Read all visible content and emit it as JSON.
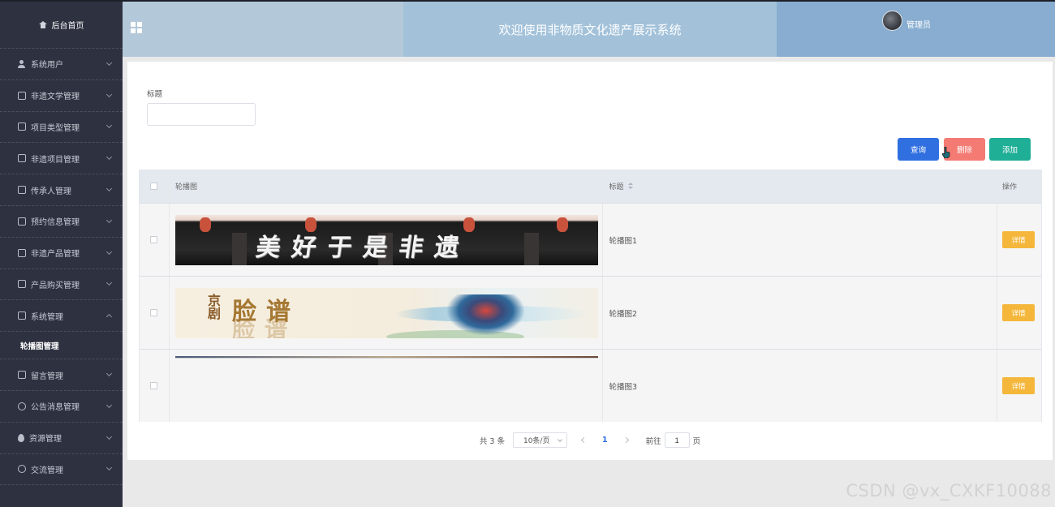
{
  "sidebar": {
    "home": "后台首页",
    "items": [
      {
        "label": "系统用户",
        "icon": "user-icon"
      },
      {
        "label": "非遗文学管理",
        "icon": "document-icon"
      },
      {
        "label": "项目类型管理",
        "icon": "document-icon"
      },
      {
        "label": "非遗项目管理",
        "icon": "document-icon"
      },
      {
        "label": "传承人管理",
        "icon": "document-icon"
      },
      {
        "label": "预约信息管理",
        "icon": "document-icon"
      },
      {
        "label": "非遗产品管理",
        "icon": "document-icon"
      },
      {
        "label": "产品购买管理",
        "icon": "document-icon"
      },
      {
        "label": "系统管理",
        "icon": "picture-icon",
        "expanded": true
      },
      {
        "label": "留言管理",
        "icon": "picture-icon"
      },
      {
        "label": "公告消息管理",
        "icon": "info-icon"
      },
      {
        "label": "资源管理",
        "icon": "location-icon"
      },
      {
        "label": "交流管理",
        "icon": "chat-icon"
      }
    ],
    "submenu_active": "轮播图管理"
  },
  "header": {
    "title": "欢迎使用非物质文化遗产展示系统",
    "user": "管理员"
  },
  "search": {
    "label": "标题",
    "value": ""
  },
  "buttons": {
    "query": "查询",
    "delete": "删除",
    "add": "添加"
  },
  "table": {
    "columns": {
      "image": "轮播图",
      "title": "标题",
      "action": "操作"
    },
    "rows": [
      {
        "title": "轮播图1",
        "action": "详情",
        "banner_text": "美好于是非遗"
      },
      {
        "title": "轮播图2",
        "action": "详情",
        "banner_text": "脸谱"
      },
      {
        "title": "轮播图3",
        "action": "详情"
      }
    ]
  },
  "pagination": {
    "total": "共 3 条",
    "page_size": "10条/页",
    "current_page": "1",
    "goto_label": "前往",
    "goto_value": "1",
    "page_suffix": "页"
  },
  "watermark": "CSDN @vx_CXKF10088",
  "colors": {
    "sidebar_bg": "#2d3140",
    "query_btn": "#2f6fe0",
    "delete_btn": "#f47b73",
    "add_btn": "#1fae96",
    "detail_btn": "#f5b73b"
  }
}
